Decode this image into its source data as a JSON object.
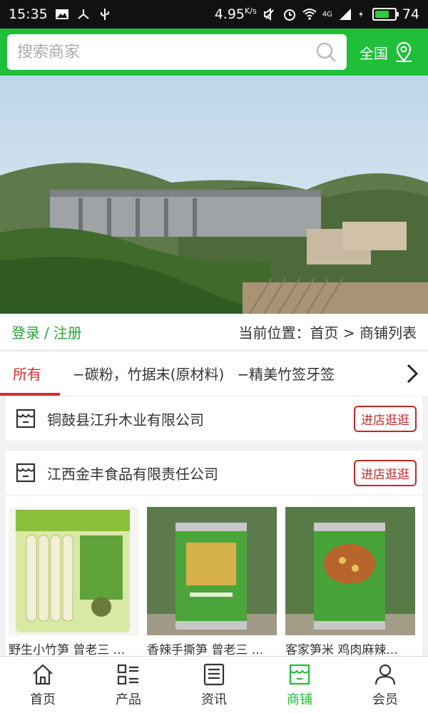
{
  "status_bar": {
    "time": "15:35",
    "speed": "4.95",
    "speed_unit": "K/s",
    "network": "4G",
    "battery": "74"
  },
  "header": {
    "search_placeholder": "搜索商家",
    "region_label": "全国"
  },
  "crumbbar": {
    "login": "登录",
    "separator": "/",
    "register": "注册",
    "location": "当前位置：首页 > 商铺列表"
  },
  "tabs": [
    {
      "label": "所有",
      "active": true
    },
    {
      "label": "−碳粉，竹据末(原材料)"
    },
    {
      "label": "−精美竹签牙签"
    }
  ],
  "shops": [
    {
      "name": "铜鼓县江升木业有限公司",
      "enter_label": "进店逛逛"
    },
    {
      "name": "江西金丰食品有限责任公司",
      "enter_label": "进店逛逛",
      "products": [
        {
          "name": "野生小竹笋 曾老三 ..."
        },
        {
          "name": "香辣手撕笋 曾老三 ..."
        },
        {
          "name": "客家笋米 鸡肉麻辣..."
        }
      ]
    }
  ],
  "bottom_nav": [
    {
      "label": "首页",
      "icon": "home-icon"
    },
    {
      "label": "产品",
      "icon": "grid-list-icon"
    },
    {
      "label": "资讯",
      "icon": "news-icon"
    },
    {
      "label": "商铺",
      "icon": "store-icon",
      "active": true
    },
    {
      "label": "会员",
      "icon": "user-icon"
    }
  ],
  "colors": {
    "brand_green": "#1fbf3a",
    "accent_red": "#d32f2f"
  }
}
